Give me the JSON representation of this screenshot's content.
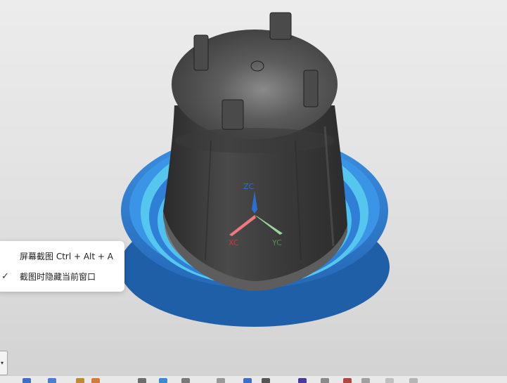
{
  "viewport": {
    "triad": {
      "z_label": "ZC",
      "x_label": "XC",
      "y_label": "YC",
      "z_color": "#2b6fd6",
      "x_color": "#d0343c",
      "y_color": "#4f8f4f"
    },
    "model_colors": {
      "body": "#3a3a3a",
      "base": "#2f7fd6",
      "base_light": "#5fd0f0"
    }
  },
  "context_menu": {
    "items": [
      {
        "label": "屏幕截图 Ctrl + Alt + A",
        "checked": false
      },
      {
        "label": "截图时隐藏当前窗口",
        "checked": true
      }
    ],
    "check_glyph": "✓"
  },
  "dropdown": {
    "arrow": "▾"
  },
  "toolbar": {
    "icons": [
      "toolbar-icon-1",
      "toolbar-icon-2",
      "toolbar-icon-3",
      "toolbar-icon-4",
      "toolbar-icon-5",
      "toolbar-icon-6",
      "toolbar-icon-7",
      "toolbar-icon-8",
      "toolbar-icon-9",
      "toolbar-icon-10",
      "toolbar-icon-11",
      "toolbar-icon-12",
      "toolbar-icon-13",
      "toolbar-icon-14",
      "toolbar-icon-15",
      "toolbar-icon-16"
    ]
  }
}
